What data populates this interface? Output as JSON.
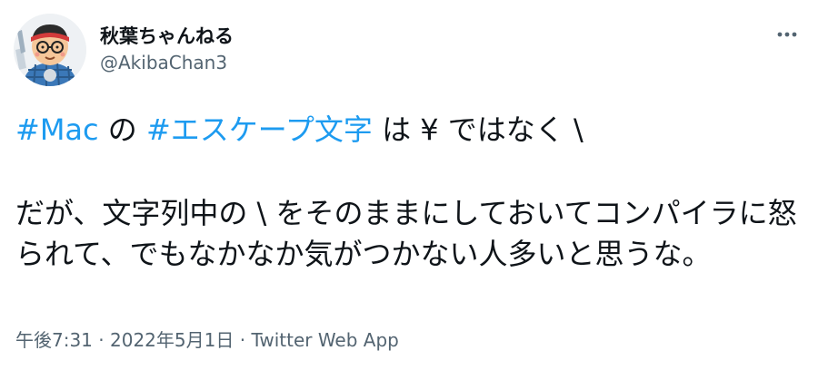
{
  "author": {
    "display_name": "秋葉ちゃんねる",
    "handle": "@AkibaChan3"
  },
  "tweet": {
    "line1": {
      "hashtag_mac": "#Mac",
      "t1": " の ",
      "hashtag_escape": "#エスケープ文字",
      "t2": " は ¥ ではなく \\"
    },
    "paragraph2": "だが、文字列中の \\ をそのままにしておいてコンパイラに怒られて、でもなかなか気がつかない人多いと思うな。"
  },
  "meta": {
    "time": "午後7:31",
    "sep1": " · ",
    "date": "2022年5月1日",
    "sep2": " · ",
    "source": "Twitter Web App"
  },
  "colors": {
    "link": "#1d9bf0",
    "text": "#0f1419",
    "secondary": "#536471"
  }
}
